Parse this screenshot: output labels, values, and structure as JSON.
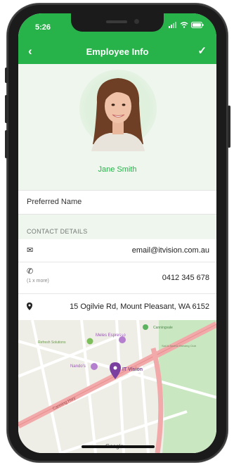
{
  "status_bar": {
    "time": "5:26"
  },
  "navbar": {
    "back_icon": "chevron-left-icon",
    "title": "Employee Info",
    "confirm_icon": "checkmark-icon"
  },
  "profile": {
    "name": "Jane Smith"
  },
  "preferred_name": {
    "label": "Preferred Name",
    "value": ""
  },
  "contact": {
    "section_label": "CONTACT DETAILS",
    "email": {
      "icon": "envelope-icon",
      "value": "email@itvision.com.au"
    },
    "phone": {
      "icon": "phone-icon",
      "sub_label": "(1 x more)",
      "value": "0412 345 678"
    },
    "address": {
      "icon": "location-pin-icon",
      "value": "15 Ogilvie Rd, Mount Pleasant, WA 6152"
    }
  },
  "map": {
    "places": {
      "meles": "Meles Espresso",
      "refresh": "Refresh Solutions",
      "nandos": "Nando's",
      "itvision": "IT Vision",
      "canning_hwy": "Canning Hwy",
      "brewing": "Sail & Anchor Brewing Club",
      "carbook": "Canningvale",
      "google": "Google"
    },
    "colors": {
      "highway": "#f2a9a9",
      "park": "#c9e7c0",
      "pin": "#7b3fa0"
    }
  },
  "colors": {
    "brand_green": "#27b24a"
  }
}
